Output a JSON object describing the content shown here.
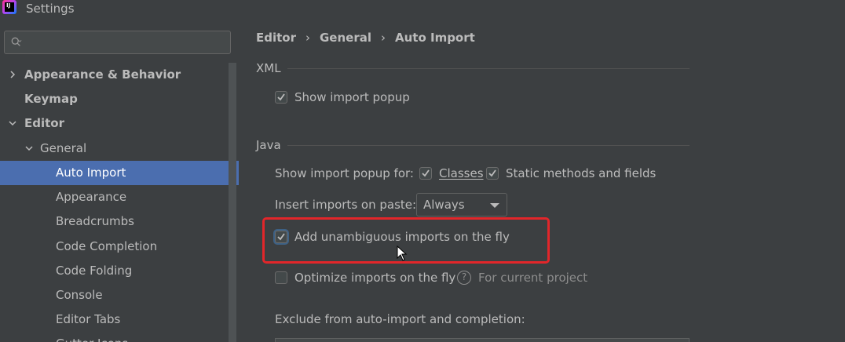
{
  "window": {
    "title": "Settings",
    "logo_text": "IJ"
  },
  "sidebar": {
    "search": {
      "placeholder": ""
    },
    "items": [
      {
        "label": "Appearance & Behavior",
        "bold": true,
        "expander": "collapsed"
      },
      {
        "label": "Keymap",
        "bold": true,
        "expander": "none"
      },
      {
        "label": "Editor",
        "bold": true,
        "expander": "expanded"
      },
      {
        "label": "General",
        "bold": false,
        "expander": "expanded"
      },
      {
        "label": "Auto Import",
        "bold": false,
        "selected": true
      },
      {
        "label": "Appearance",
        "bold": false
      },
      {
        "label": "Breadcrumbs",
        "bold": false
      },
      {
        "label": "Code Completion",
        "bold": false
      },
      {
        "label": "Code Folding",
        "bold": false
      },
      {
        "label": "Console",
        "bold": false
      },
      {
        "label": "Editor Tabs",
        "bold": false
      },
      {
        "label": "Gutter Icons",
        "bold": false
      }
    ]
  },
  "main": {
    "breadcrumb": [
      "Editor",
      "General",
      "Auto Import"
    ],
    "breadcrumb_separator": "›",
    "xml": {
      "section_title": "XML",
      "show_import_popup": {
        "label": "Show import popup",
        "checked": true
      }
    },
    "java": {
      "section_title": "Java",
      "show_import_popup_for_label": "Show import popup for:",
      "classes": {
        "label": "Classes",
        "checked": true
      },
      "static_methods": {
        "label": "Static methods and fields",
        "checked": true
      },
      "insert_on_paste_label": "Insert imports on paste:",
      "insert_on_paste_value": "Always",
      "add_unambiguous": {
        "label": "Add unambiguous imports on the fly",
        "checked": true
      },
      "optimize_imports": {
        "label": "Optimize imports on the fly",
        "checked": false
      },
      "for_current_project": "For current project",
      "help_glyph": "?",
      "exclude_label": "Exclude from auto-import and completion:"
    }
  },
  "colors": {
    "background": "#3c3f41",
    "selection": "#4b6eaf",
    "highlight_border": "#e2262a",
    "text": "#bbbbbb"
  }
}
